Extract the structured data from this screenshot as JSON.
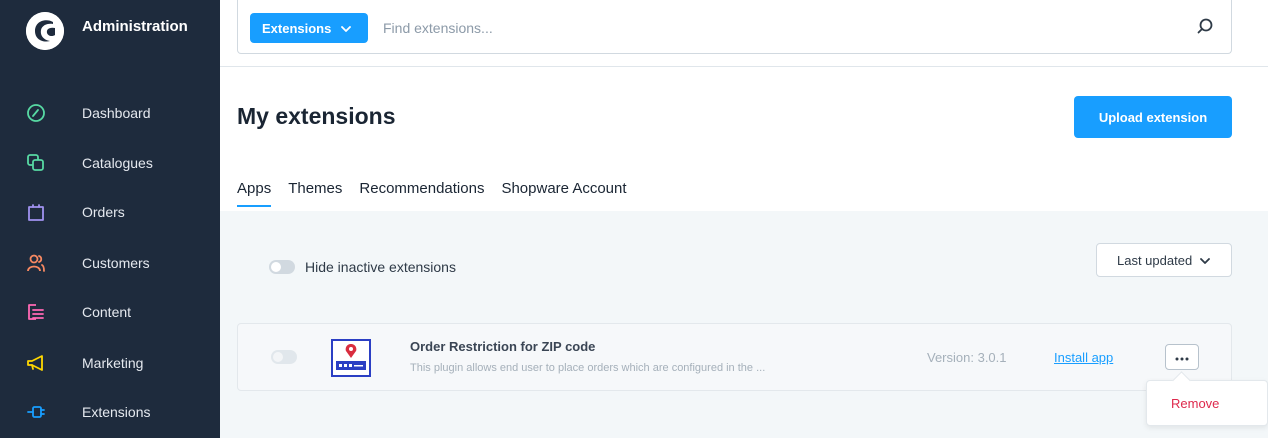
{
  "app": {
    "title": "Administration"
  },
  "sidebar": {
    "items": [
      {
        "label": "Dashboard",
        "icon": "dashboard-gauge-icon",
        "color": "#57d9a3"
      },
      {
        "label": "Catalogues",
        "icon": "catalogue-icon",
        "color": "#57d9a3"
      },
      {
        "label": "Orders",
        "icon": "shopping-bag-icon",
        "color": "#a092f0"
      },
      {
        "label": "Customers",
        "icon": "users-icon",
        "color": "#f88962"
      },
      {
        "label": "Content",
        "icon": "content-icon",
        "color": "#ff68b4"
      },
      {
        "label": "Marketing",
        "icon": "megaphone-icon",
        "color": "#ffd700"
      },
      {
        "label": "Extensions",
        "icon": "plug-icon",
        "color": "#189eff"
      }
    ]
  },
  "search": {
    "type_label": "Extensions",
    "placeholder": "Find extensions..."
  },
  "page": {
    "title": "My extensions",
    "upload_label": "Upload extension"
  },
  "tabs": [
    {
      "label": "Apps",
      "active": true
    },
    {
      "label": "Themes",
      "active": false
    },
    {
      "label": "Recommendations",
      "active": false
    },
    {
      "label": "Shopware Account",
      "active": false
    }
  ],
  "filters": {
    "hide_inactive_label": "Hide inactive extensions",
    "hide_inactive_on": false,
    "sort_label": "Last updated"
  },
  "extensions": [
    {
      "name": "Order Restriction for ZIP code",
      "description": "This plugin allows end user to place orders which are configured in the ...",
      "version_label": "Version: 3.0.1",
      "install_label": "Install app",
      "active": false
    }
  ],
  "context_menu": {
    "remove_label": "Remove"
  },
  "colors": {
    "accent": "#189eff",
    "sidebar_bg": "#1e2b3d",
    "danger": "#de294c"
  }
}
